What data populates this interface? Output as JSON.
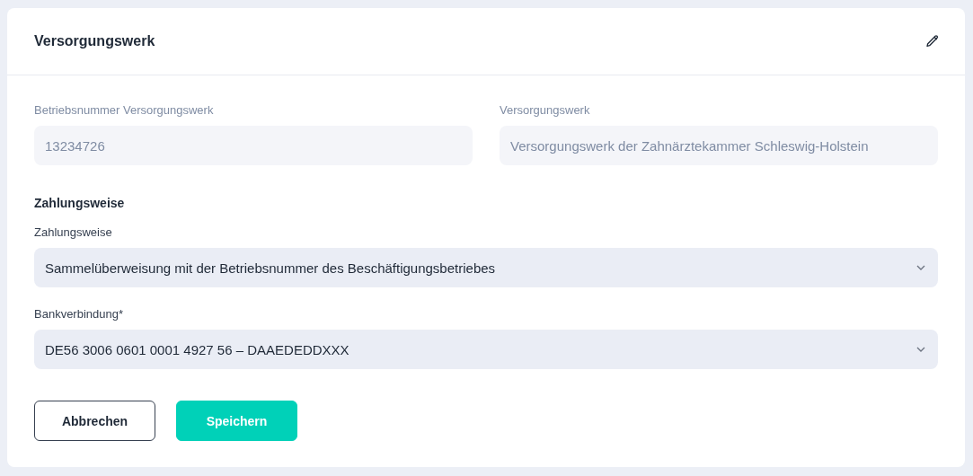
{
  "card": {
    "title": "Versorgungswerk"
  },
  "fields": [
    {
      "label": "Betriebsnummer Versorgungswerk",
      "value": "13234726",
      "disabled": true
    },
    {
      "label": "Versorgungswerk",
      "value": "Versorgungswerk der Zahnärztekammer Schleswig-Holstein",
      "disabled": true
    }
  ],
  "section": {
    "title": "Zahlungsweise"
  },
  "selects": [
    {
      "label": "Zahlungsweise",
      "value": "Sammelüberweisung mit der Betriebsnummer des Beschäftigungsbetriebes"
    },
    {
      "label": "Bankverbindung*",
      "value": "DE56 3006 0601 0001 4927 56 – DAAEDEDDXXX"
    }
  ],
  "buttons": [
    {
      "label": "Abbrechen",
      "kind": "secondary"
    },
    {
      "label": "Speichern",
      "kind": "primary"
    }
  ]
}
